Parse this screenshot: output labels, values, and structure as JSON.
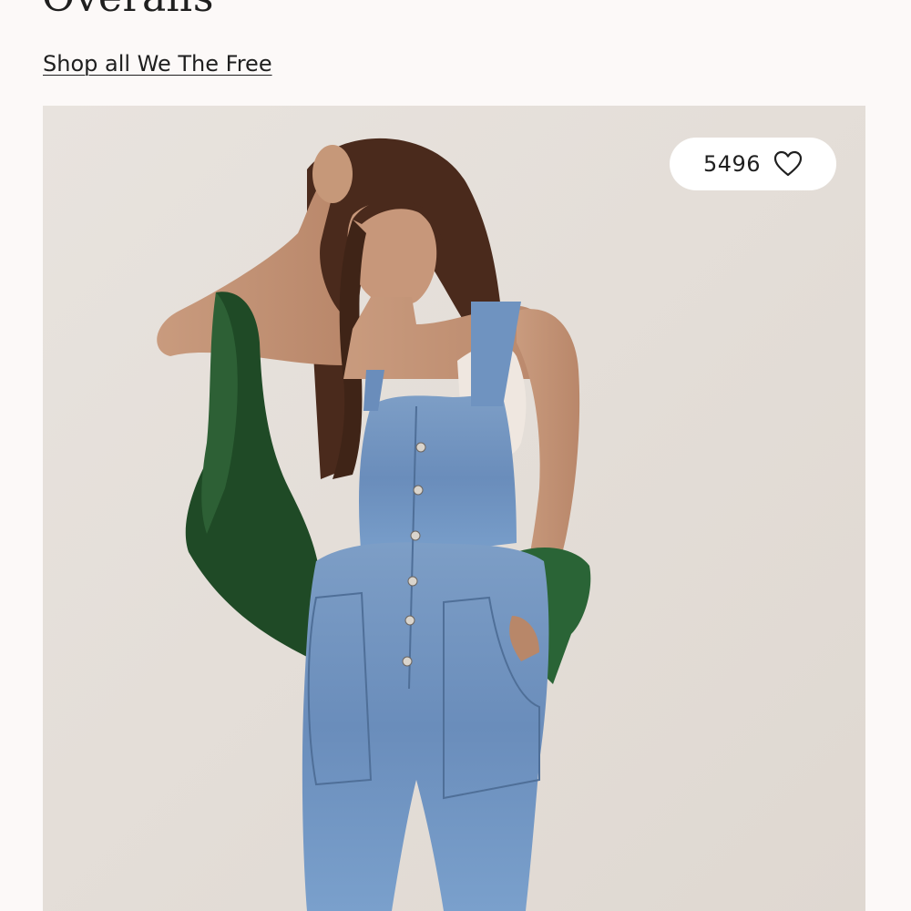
{
  "product": {
    "title": "Overalls",
    "shop_link": "Shop all We The Free"
  },
  "image": {
    "alt": "Model wearing denim overalls",
    "background_color": "#e6e1dc"
  },
  "favorites": {
    "count": "5496",
    "icon": "heart-icon"
  }
}
